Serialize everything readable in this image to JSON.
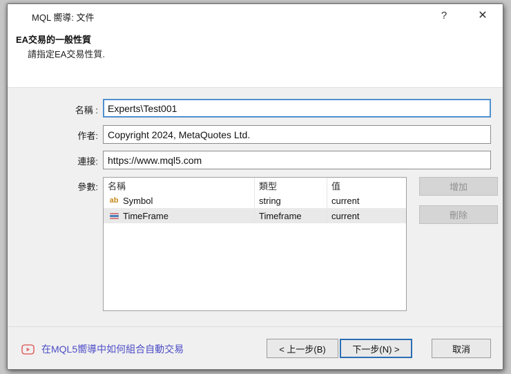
{
  "window": {
    "title": "MQL 嚮導: 文件",
    "help_glyph": "?",
    "close_glyph": "✕"
  },
  "header": {
    "title": "EA交易的一般性質",
    "subtitle": "請指定EA交易性質."
  },
  "form": {
    "name": {
      "label": "名稱 :",
      "value": "Experts\\Test001"
    },
    "author": {
      "label": "作者:",
      "value": "Copyright 2024, MetaQuotes Ltd."
    },
    "link": {
      "label": "連接:",
      "value": "https://www.mql5.com"
    },
    "parameters": {
      "label": "參數:",
      "columns": [
        "名稱",
        "類型",
        "值"
      ],
      "rows": [
        {
          "icon": "string-type-icon",
          "icon_glyph": "ab",
          "name": "Symbol",
          "type": "string",
          "value": "current",
          "selected": false
        },
        {
          "icon": "timeframe-type-icon",
          "icon_glyph": "",
          "name": "TimeFrame",
          "type": "Timeframe",
          "value": "current",
          "selected": true
        }
      ],
      "add_label": "增加",
      "delete_label": "刪除"
    }
  },
  "footer": {
    "video_link_text": "在MQL5嚮導中如何組合自動交易",
    "back_label": "< 上一步(B)",
    "next_label": "下一步(N) >",
    "cancel_label": "取消"
  },
  "colors": {
    "focus_border_blue": "#4f8fd0",
    "next_button_border": "#2a6db4",
    "link_purple": "#4d4dc8",
    "string_icon_orange": "#c8891c",
    "timeframe_icon_blue": "#4a7ebb",
    "timeframe_icon_red": "#cf7f7f",
    "selected_row_bg": "#e9e9e9",
    "body_bg": "#f0f0f0",
    "header_bg": "#ffffff"
  }
}
